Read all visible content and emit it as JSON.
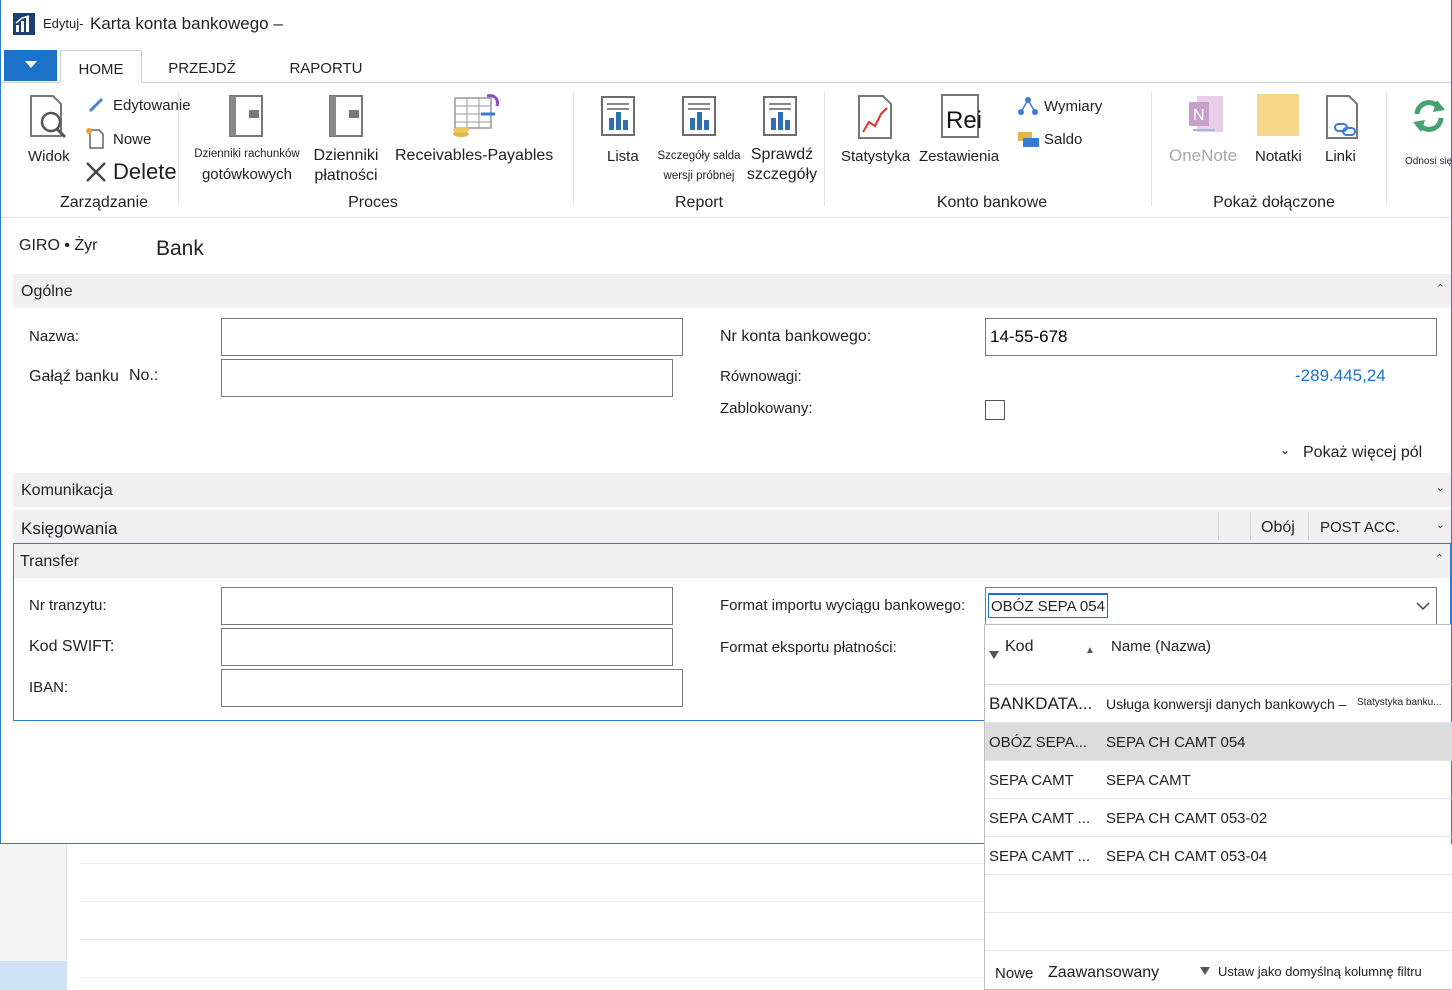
{
  "window": {
    "edit_prefix": "Edytuj-",
    "title": "Karta konta bankowego –"
  },
  "tabs": {
    "app_menu_icon": "triangle-down-icon",
    "home": "HOME",
    "przejdz": "PRZEJDŹ",
    "raportu": "RAPORTU"
  },
  "ribbon": {
    "zarzadzanie": {
      "label": "Zarządzanie",
      "widok": "Widok",
      "edytowanie": "Edytowanie",
      "nowe": "Nowe",
      "delete": "Delete"
    },
    "proces": {
      "label": "Proces",
      "dzienniki_rachunkow": "Dzienniki rachunków",
      "gotowkowych": "gotówkowych",
      "dzienniki": "Dzienniki",
      "platnosci": "płatności",
      "receivables": "Receivables-Payables"
    },
    "report": {
      "label": "Report",
      "lista": "Lista",
      "szczegoly_salda": "Szczegóły salda",
      "wersji_probnej": "wersji próbnej",
      "sprawdz": "Sprawdź",
      "szczegoly": "szczegóły"
    },
    "konto": {
      "label": "Konto bankowe",
      "statystyka": "Statystyka",
      "zestawienia": "Zestawienia",
      "rei": "Rei",
      "wymiary": "Wymiary",
      "saldo": "Saldo"
    },
    "pokaz": {
      "label": "Pokaż dołączone",
      "onenote": "OneNote",
      "notatki": "Notatki",
      "linki": "Linki"
    },
    "odnosi": "Odnosi się"
  },
  "header": {
    "giro": "GIRO • Żyr",
    "title": "Bank"
  },
  "ogolne": {
    "label": "Ogólne",
    "nazwa_label": "Nazwa:",
    "nazwa_value": "",
    "galaz_label": "Gałąź banku",
    "no_label": "No.:",
    "galaz_value": "",
    "nr_konta_label": "Nr konta bankowego:",
    "nr_konta_value": "14-55-678",
    "rownowagi_label": "Równowagi:",
    "rownowagi_value": "-289.445,24",
    "zablokowany_label": "Zablokowany:",
    "pokaz_wiecej": "Pokaż więcej pól"
  },
  "komunikacja": {
    "label": "Komunikacja"
  },
  "ksiegowania": {
    "label": "Księgowania",
    "oboj": "Obój",
    "post_acc": "POST ACC."
  },
  "transfer": {
    "label": "Transfer",
    "nr_tranzytu_label": "Nr tranzytu:",
    "kod_swift_label": "Kod SWIFT:",
    "iban_label": "IBAN:",
    "format_importu_label": "Format importu wyciągu bankowego:",
    "format_importu_value": "OBÓZ SEPA 054",
    "format_eksportu_label": "Format eksportu płatności:"
  },
  "lookup": {
    "col_kod": "Kod",
    "col_name": "Name (Nazwa)",
    "rows": [
      {
        "code": "BANKDATA...",
        "name": "Usługa konwersji danych bankowych –",
        "extra": "Statystyka banku..."
      },
      {
        "code": "OBÓZ SEPA...",
        "name": "SEPA CH CAMT 054",
        "extra": ""
      },
      {
        "code": "SEPA CAMT",
        "name": "SEPA CAMT",
        "extra": ""
      },
      {
        "code": "SEPA CAMT ...",
        "name": "SEPA CH CAMT 053-02",
        "extra": ""
      },
      {
        "code": "SEPA CAMT ...",
        "name": "SEPA CH CAMT 053-04",
        "extra": ""
      }
    ],
    "footer_nowe": "Nowe",
    "footer_zaawansowany": "Zaawansowany",
    "footer_ustaw": "Ustaw jako domyślną kolumnę filtru"
  },
  "colors": {
    "accent": "#1a73c9",
    "link_value": "#1a73c9",
    "selected_row": "#dcdcdc"
  }
}
